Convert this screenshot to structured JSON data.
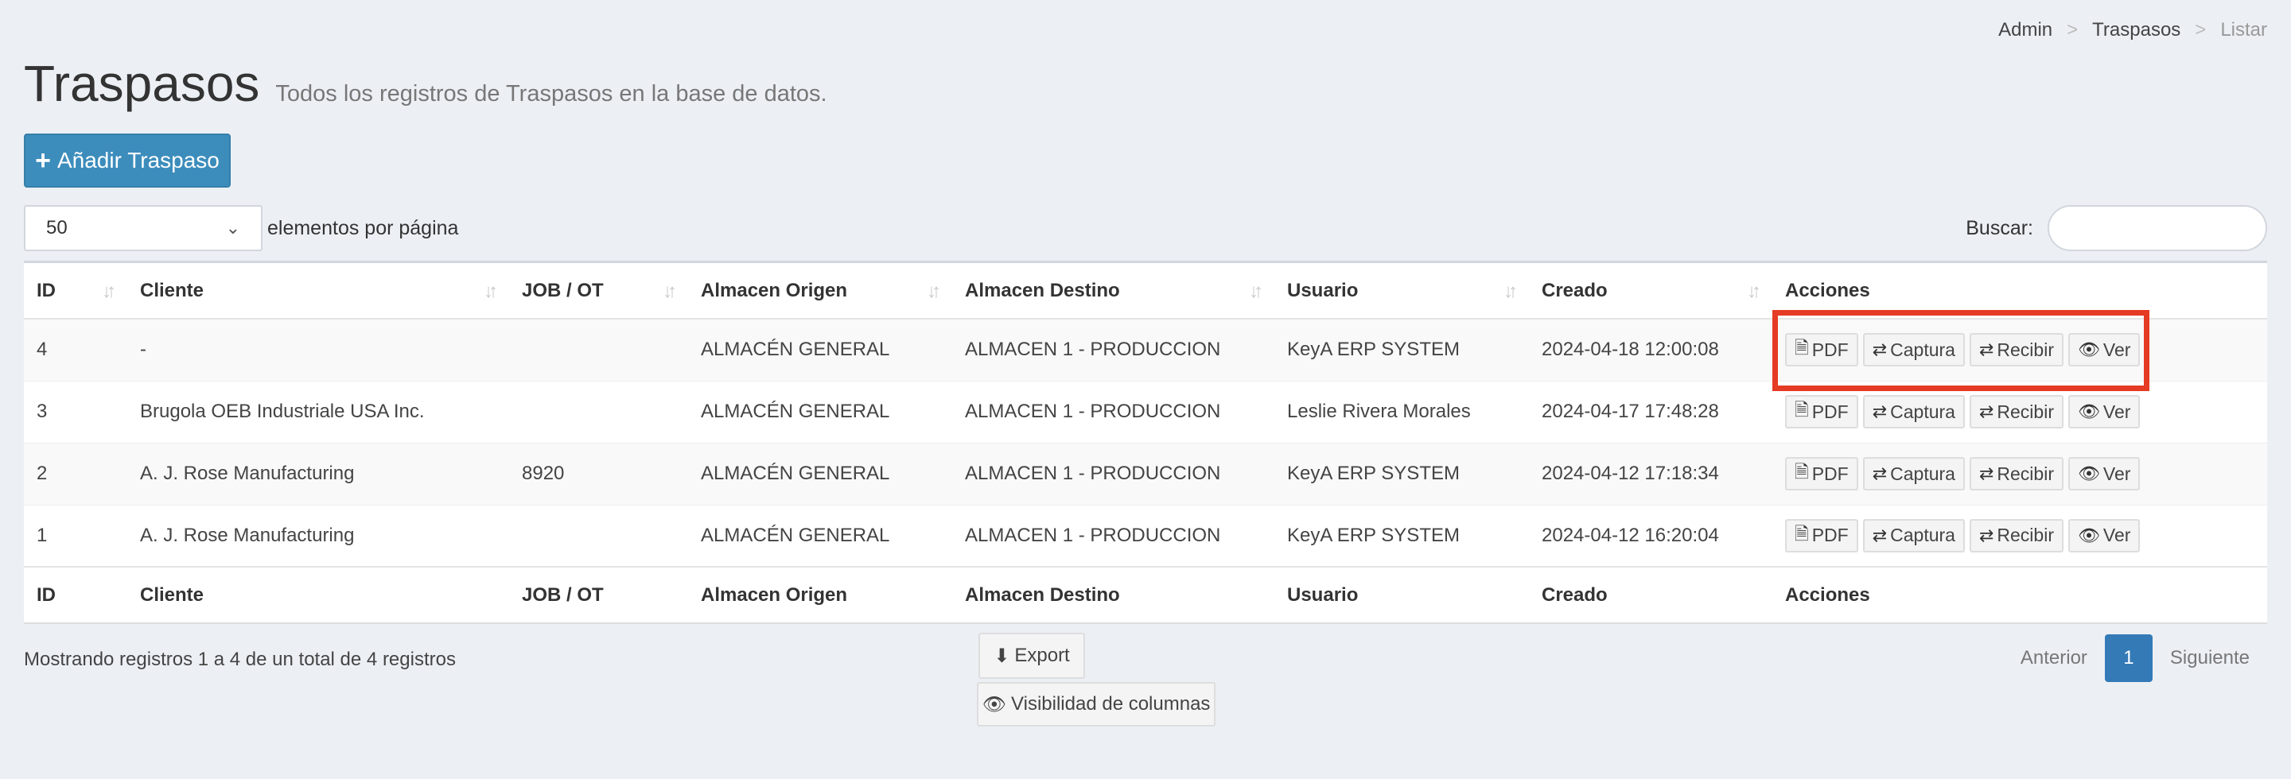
{
  "breadcrumb": [
    "Admin",
    "Traspasos",
    "Listar"
  ],
  "header": {
    "title": "Traspasos",
    "subtitle": "Todos los registros de Traspasos en la base de datos."
  },
  "add_button": "Añadir Traspaso",
  "length": {
    "value": "50",
    "label": "elementos por página"
  },
  "search": {
    "label": "Buscar:",
    "placeholder": ""
  },
  "columns": [
    "ID",
    "Cliente",
    "JOB / OT",
    "Almacen Origen",
    "Almacen Destino",
    "Usuario",
    "Creado",
    "Acciones"
  ],
  "rows": [
    {
      "id": "4",
      "cliente": "-",
      "job": "",
      "origen": "ALMACÉN GENERAL",
      "destino": "ALMACEN 1 - PRODUCCION",
      "usuario": "KeyA ERP SYSTEM",
      "creado": "2024-04-18 12:00:08"
    },
    {
      "id": "3",
      "cliente": "Brugola OEB Industriale USA Inc.",
      "job": "",
      "origen": "ALMACÉN GENERAL",
      "destino": "ALMACEN 1 - PRODUCCION",
      "usuario": "Leslie Rivera Morales",
      "creado": "2024-04-17 17:48:28"
    },
    {
      "id": "2",
      "cliente": "A. J. Rose Manufacturing",
      "job": "8920",
      "origen": "ALMACÉN GENERAL",
      "destino": "ALMACEN 1 - PRODUCCION",
      "usuario": "KeyA ERP SYSTEM",
      "creado": "2024-04-12 17:18:34"
    },
    {
      "id": "1",
      "cliente": "A. J. Rose Manufacturing",
      "job": "",
      "origen": "ALMACÉN GENERAL",
      "destino": "ALMACEN 1 - PRODUCCION",
      "usuario": "KeyA ERP SYSTEM",
      "creado": "2024-04-12 16:20:04"
    }
  ],
  "actions": {
    "pdf": "PDF",
    "captura": "Captura",
    "recibir": "Recibir",
    "ver": "Ver"
  },
  "info": "Mostrando registros 1 a 4 de un total de 4 registros",
  "export_button": "Export",
  "colvis_button": "Visibilidad de columnas",
  "pager": {
    "prev": "Anterior",
    "current": "1",
    "next": "Siguiente"
  },
  "colors": {
    "primary": "#3c8dbc",
    "highlight": "#e53a23",
    "background": "#ecf0f5"
  }
}
